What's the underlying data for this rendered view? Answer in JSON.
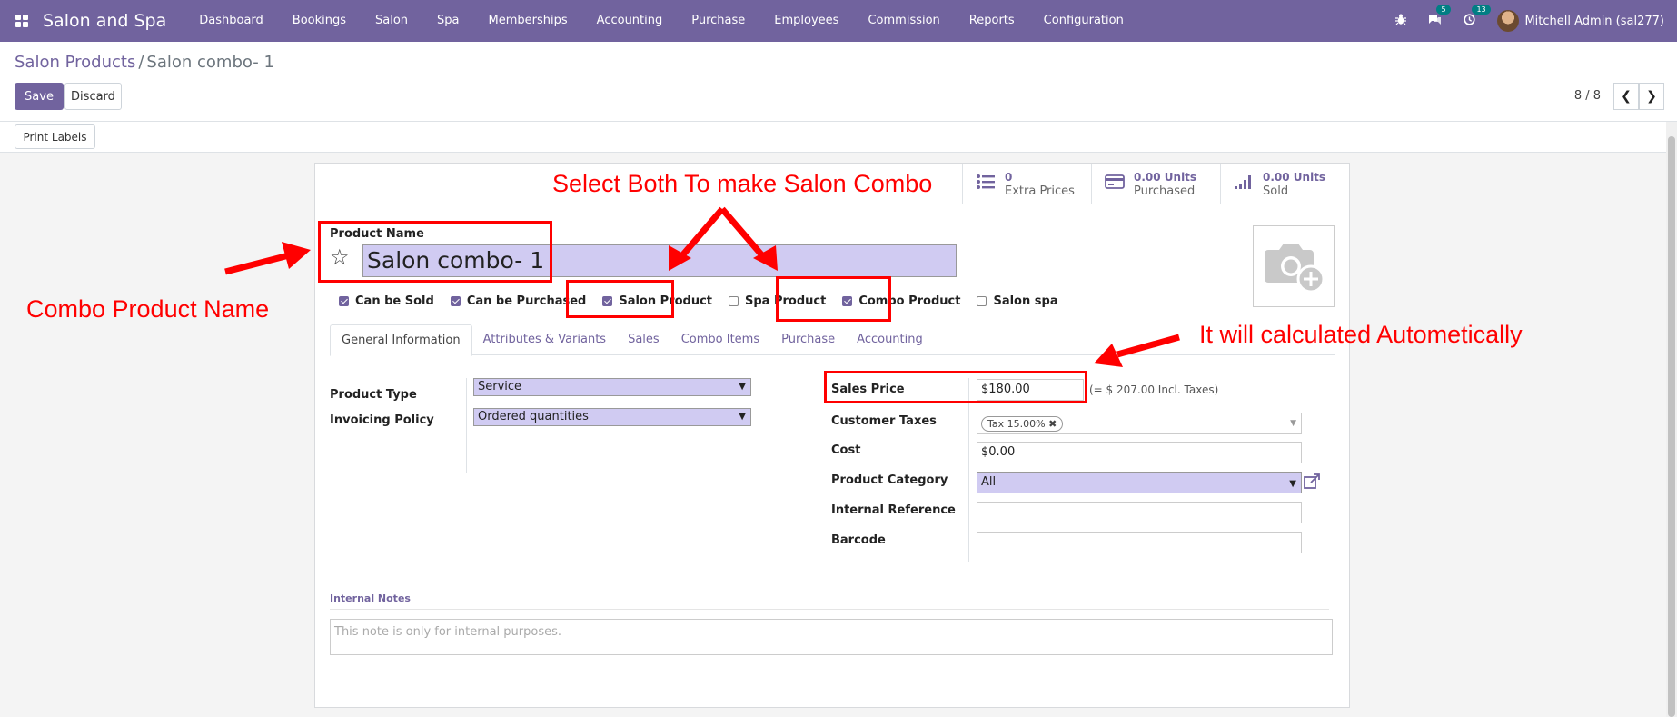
{
  "app": {
    "name": "Salon and Spa"
  },
  "menu": [
    "Dashboard",
    "Bookings",
    "Salon",
    "Spa",
    "Memberships",
    "Accounting",
    "Purchase",
    "Employees",
    "Commission",
    "Reports",
    "Configuration"
  ],
  "systray": {
    "messages_count": "5",
    "activities_count": "13",
    "user": "Mitchell Admin (sal277)"
  },
  "breadcrumb": {
    "parent": "Salon Products",
    "separator": "/",
    "current": "Salon combo- 1"
  },
  "actions": {
    "save": "Save",
    "discard": "Discard",
    "print_labels": "Print Labels"
  },
  "pager": {
    "value": "8 / 8"
  },
  "smart_buttons": [
    {
      "value": "0",
      "label": "Extra Prices",
      "icon": "list-icon"
    },
    {
      "value": "0.00 Units",
      "label": "Purchased",
      "icon": "credit-card-icon"
    },
    {
      "value": "0.00 Units",
      "label": "Sold",
      "icon": "signal-icon"
    }
  ],
  "form": {
    "product_name_label": "Product Name",
    "product_name": "Salon combo- 1",
    "checkboxes": [
      {
        "label": "Can be Sold",
        "checked": true
      },
      {
        "label": "Can be Purchased",
        "checked": true
      },
      {
        "label": "Salon Product",
        "checked": true
      },
      {
        "label": "Spa Product",
        "checked": false
      },
      {
        "label": "Combo Product",
        "checked": true
      },
      {
        "label": "Salon spa",
        "checked": false
      }
    ],
    "tabs": [
      "General Information",
      "Attributes & Variants",
      "Sales",
      "Combo Items",
      "Purchase",
      "Accounting"
    ],
    "active_tab": "General Information",
    "product_type_label": "Product Type",
    "product_type": "Service",
    "invoicing_policy_label": "Invoicing Policy",
    "invoicing_policy": "Ordered quantities",
    "sales_price_label": "Sales Price",
    "sales_price": "$180.00",
    "sales_price_incl": "(= $ 207.00 Incl. Taxes)",
    "customer_taxes_label": "Customer Taxes",
    "customer_tax_tag": "Tax 15.00%",
    "cost_label": "Cost",
    "cost": "$0.00",
    "product_category_label": "Product Category",
    "product_category": "All",
    "internal_reference_label": "Internal Reference",
    "internal_reference": "",
    "barcode_label": "Barcode",
    "barcode": "",
    "internal_notes_label": "Internal Notes",
    "internal_notes_placeholder": "This note is only for internal purposes."
  },
  "annotations": {
    "top": "Select Both To make Salon Combo",
    "left": "Combo Product Name",
    "right": "It will calculated Autometically",
    "color": "#ff0000"
  },
  "colors": {
    "brand": "#71639e",
    "highlight_field": "#d0cbf2",
    "badge": "#017e84"
  }
}
